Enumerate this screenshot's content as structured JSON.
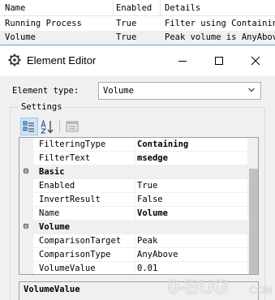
{
  "list": {
    "columns": [
      "Name",
      "Enabled",
      "Details"
    ],
    "rows": [
      {
        "name": "Running Process",
        "enabled": "True",
        "details": "Filter using Containin..."
      },
      {
        "name": "Volume",
        "enabled": "True",
        "details": "Peak volume is AnyAbov..."
      }
    ]
  },
  "dialog": {
    "title": "Element Editor",
    "element_type_label": "Element type:",
    "element_type_value": "Volume",
    "settings_label": "Settings",
    "grid": {
      "rows": [
        {
          "kind": "prop",
          "name": "FilteringType",
          "value": "Containing",
          "bold": true
        },
        {
          "kind": "prop",
          "name": "FilterText",
          "value": "msedge",
          "bold": true
        },
        {
          "kind": "category",
          "toggle": "⊟",
          "name": "Basic"
        },
        {
          "kind": "prop",
          "name": "Enabled",
          "value": "True",
          "bold": false
        },
        {
          "kind": "prop",
          "name": "InvertResult",
          "value": "False",
          "bold": false
        },
        {
          "kind": "prop",
          "name": "Name",
          "value": "Volume",
          "bold": true
        },
        {
          "kind": "category",
          "toggle": "⊟",
          "name": "Volume"
        },
        {
          "kind": "prop",
          "name": "ComparisonTarget",
          "value": "Peak",
          "bold": false
        },
        {
          "kind": "prop",
          "name": "ComparisonType",
          "value": "AnyAbove",
          "bold": false
        },
        {
          "kind": "prop",
          "name": "VolumeValue",
          "value": "0.01",
          "bold": false
        }
      ]
    },
    "help_title": "VolumeValue"
  },
  "watermark": {
    "text": "0-BUG",
    "sub": "COM"
  },
  "colors": {
    "accent_select": "#cce4f7",
    "accent_border": "#99c9ef",
    "dialog_bg": "#f0f0f0"
  }
}
